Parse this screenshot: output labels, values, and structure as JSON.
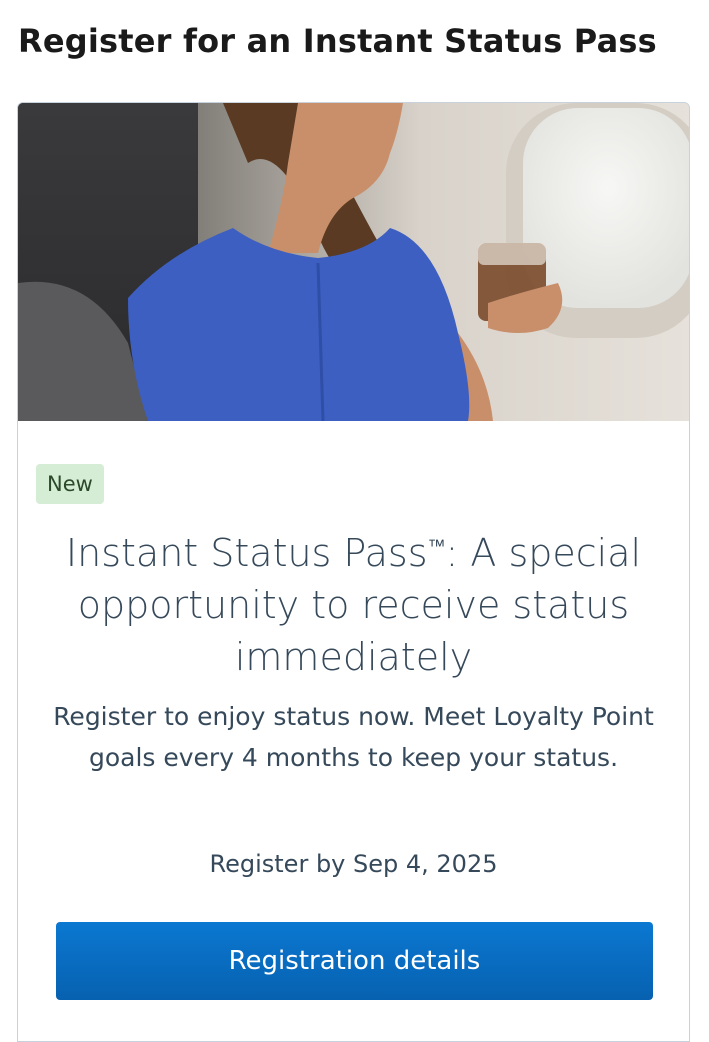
{
  "page": {
    "title": "Register for an Instant Status Pass"
  },
  "card": {
    "badge": "New",
    "headline_main": "Instant Status Pass",
    "headline_tm": "™",
    "headline_rest": ": A special opportunity to receive status immediately",
    "description": "Register to enjoy status now. Meet Loyalty Point goals every 4 months to keep your status.",
    "deadline": "Register by Sep 4, 2025",
    "cta_label": "Registration details"
  },
  "colors": {
    "cta": "#0b78d1",
    "badge_bg": "#d5ecd5",
    "text": "#36495a"
  }
}
